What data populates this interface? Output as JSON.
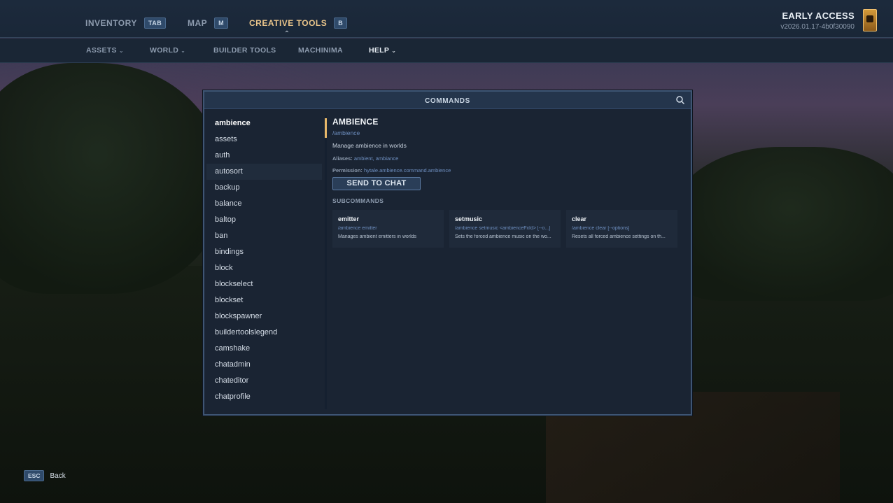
{
  "top_nav": {
    "tabs": [
      {
        "label": "INVENTORY",
        "key": "TAB"
      },
      {
        "label": "MAP",
        "key": "M"
      },
      {
        "label": "CREATIVE TOOLS",
        "key": "B"
      }
    ],
    "early_access": {
      "title": "EARLY ACCESS",
      "version": "v2026.01.17-4b0f30090"
    }
  },
  "sub_nav": {
    "items": [
      "ASSETS",
      "WORLD",
      "BUILDER TOOLS",
      "MACHINIMA",
      "HELP"
    ]
  },
  "panel": {
    "title": "COMMANDS",
    "commands": [
      "ambience",
      "assets",
      "auth",
      "autosort",
      "backup",
      "balance",
      "baltop",
      "ban",
      "bindings",
      "block",
      "blockselect",
      "blockset",
      "blockspawner",
      "buildertoolslegend",
      "camshake",
      "chatadmin",
      "chateditor",
      "chatprofile"
    ],
    "detail": {
      "title": "AMBIENCE",
      "command": "/ambience",
      "description": "Manage ambience in worlds",
      "aliases_label": "Aliases:",
      "aliases": "ambient, ambiance",
      "permission_label": "Permission:",
      "permission": "hytale.ambience.command.ambience",
      "send_button": "SEND TO CHAT",
      "subcommands_label": "SUBCOMMANDS",
      "subcommands": [
        {
          "name": "emitter",
          "usage": "/ambience emitter",
          "description": "Manages ambient emitters in worlds"
        },
        {
          "name": "setmusic",
          "usage": "/ambience setmusic <ambienceFxId> [--o...]",
          "description": "Sets the forced ambience music on the wo..."
        },
        {
          "name": "clear",
          "usage": "/ambience clear [--options]",
          "description": "Resets all forced ambience settings on th..."
        }
      ]
    }
  },
  "footer": {
    "key": "ESC",
    "label": "Back"
  }
}
